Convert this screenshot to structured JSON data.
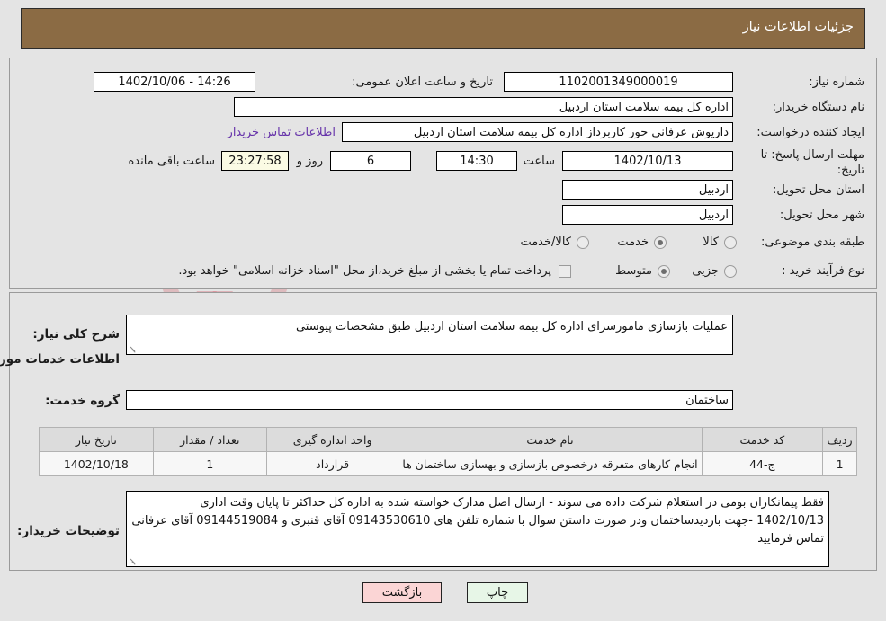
{
  "header": {
    "title": "جزئیات اطلاعات نیاز"
  },
  "watermark": {
    "text": "AriaTender.net"
  },
  "form": {
    "need_number_label": "شماره نیاز:",
    "need_number_value": "1102001349000019",
    "announce_label": "تاریخ و ساعت اعلان عمومی:",
    "announce_value": "14:26 - 1402/10/06",
    "buyer_org_label": "نام دستگاه خریدار:",
    "buyer_org_value": "اداره کل بیمه سلامت استان اردبیل",
    "creator_label": "ایجاد کننده درخواست:",
    "creator_value": "داریوش عرفانی حور کاربرداز اداره کل بیمه سلامت استان اردبیل",
    "contact_link": "اطلاعات تماس خریدار",
    "deadline_label": "مهلت ارسال پاسخ: تا تاریخ:",
    "deadline_date": "1402/10/13",
    "hour_label": "ساعت",
    "deadline_time": "14:30",
    "days_remaining": "6",
    "days_label": "روز و",
    "countdown": "23:27:58",
    "countdown_label": "ساعت باقی مانده",
    "province_label": "استان محل تحویل:",
    "province_value": "اردبیل",
    "city_label": "شهر محل تحویل:",
    "city_value": "اردبیل",
    "classification_label": "طبقه بندی موضوعی:",
    "classification_options": [
      "کالا",
      "خدمت",
      "کالا/خدمت"
    ],
    "classification_selected": "خدمت",
    "process_label": "نوع فرآیند خرید :",
    "process_options": [
      "جزیی",
      "متوسط"
    ],
    "process_selected": "متوسط",
    "treasury_note": "پرداخت تمام یا بخشی از مبلغ خرید،از محل \"اسناد خزانه اسلامی\" خواهد بود."
  },
  "description": {
    "label": "شرح کلی نیاز:",
    "value": "عملیات بازسازی مامورسرای اداره کل بیمه سلامت استان اردبیل طبق مشخصات پیوستی"
  },
  "services_section": {
    "heading": "اطلاعات خدمات مورد نیاز",
    "group_label": "گروه خدمت:",
    "group_value": "ساختمان"
  },
  "table": {
    "columns": [
      "ردیف",
      "کد خدمت",
      "نام خدمت",
      "واحد اندازه گیری",
      "تعداد / مقدار",
      "تاریخ نیاز"
    ],
    "rows": [
      {
        "row": "1",
        "code": "ج-44",
        "name": "انجام کارهای متفرقه درخصوص بازسازی و بهسازی ساختمان ها",
        "unit": "قرارداد",
        "quantity": "1",
        "date": "1402/10/18"
      }
    ]
  },
  "buyer_notes": {
    "label": "توضیحات خریدار:",
    "value": "فقط پیمانکاران بومی در استعلام شرکت داده می شوند - ارسال اصل مدارک خواسته شده به اداره کل حداکثر تا پایان وقت اداری 1402/10/13  -جهت بازدیدساختمان ودر صورت داشتن سوال با شماره تلفن های 09143530610 آقای قنبری و 09144519084 آقای عرفانی تماس فرمایید"
  },
  "buttons": {
    "print": "چاپ",
    "back": "بازگشت"
  }
}
